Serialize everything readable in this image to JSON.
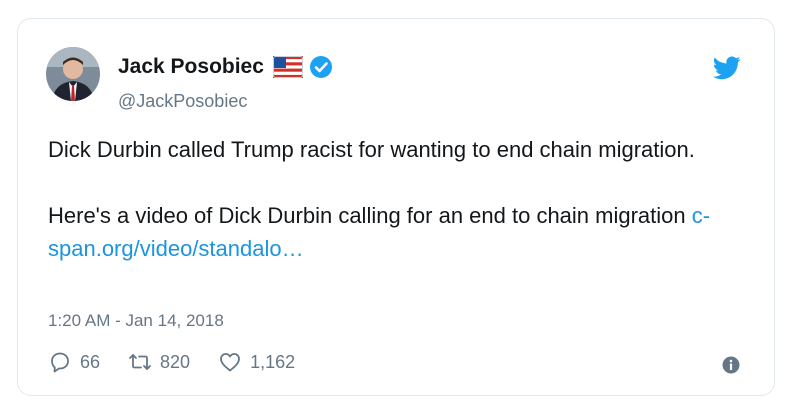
{
  "user": {
    "name": "Jack Posobiec",
    "handle": "@JackPosobiec",
    "verified": true,
    "flag_icon": "us-flag-icon",
    "verified_icon": "verified-badge-icon",
    "avatar_icon": "profile-photo"
  },
  "tweet": {
    "paragraphs": [
      "Dick Durbin called Trump racist for wanting to end chain migration.",
      "Here's a video of Dick Durbin calling for an end to chain migration"
    ],
    "link_text": "c-span.org/video/standalo…",
    "timestamp": "1:20 AM - Jan 14, 2018"
  },
  "actions": {
    "reply_count": "66",
    "retweet_count": "820",
    "like_count": "1,162",
    "reply_icon": "reply-icon",
    "retweet_icon": "retweet-icon",
    "like_icon": "heart-icon",
    "info_icon": "info-icon"
  },
  "brand": {
    "logo_icon": "twitter-bird-icon",
    "accent": "#1da1f2",
    "link_color": "#1b95e0",
    "muted_text": "#657786",
    "border": "#e1e8ed"
  }
}
